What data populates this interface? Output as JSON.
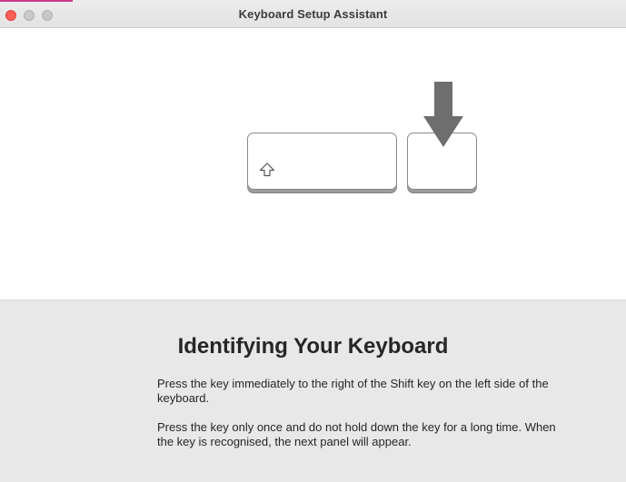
{
  "window": {
    "title": "Keyboard Setup Assistant"
  },
  "illustration": {
    "shift_key_icon": "shift-arrow-icon",
    "pointer_icon": "down-arrow-icon"
  },
  "panel": {
    "heading": "Identifying Your Keyboard",
    "paragraph_1": "Press the key immediately to the right of the Shift key on the left side of the keyboard.",
    "paragraph_2": "Press the key only once and do not hold down the key for a long time. When the key is recognised, the next panel will appear."
  },
  "colors": {
    "close_button": "#fe5f57",
    "inactive_button": "#c8c8c8",
    "panel_background": "#e8e8e8",
    "arrow": "#6e6e6e"
  }
}
